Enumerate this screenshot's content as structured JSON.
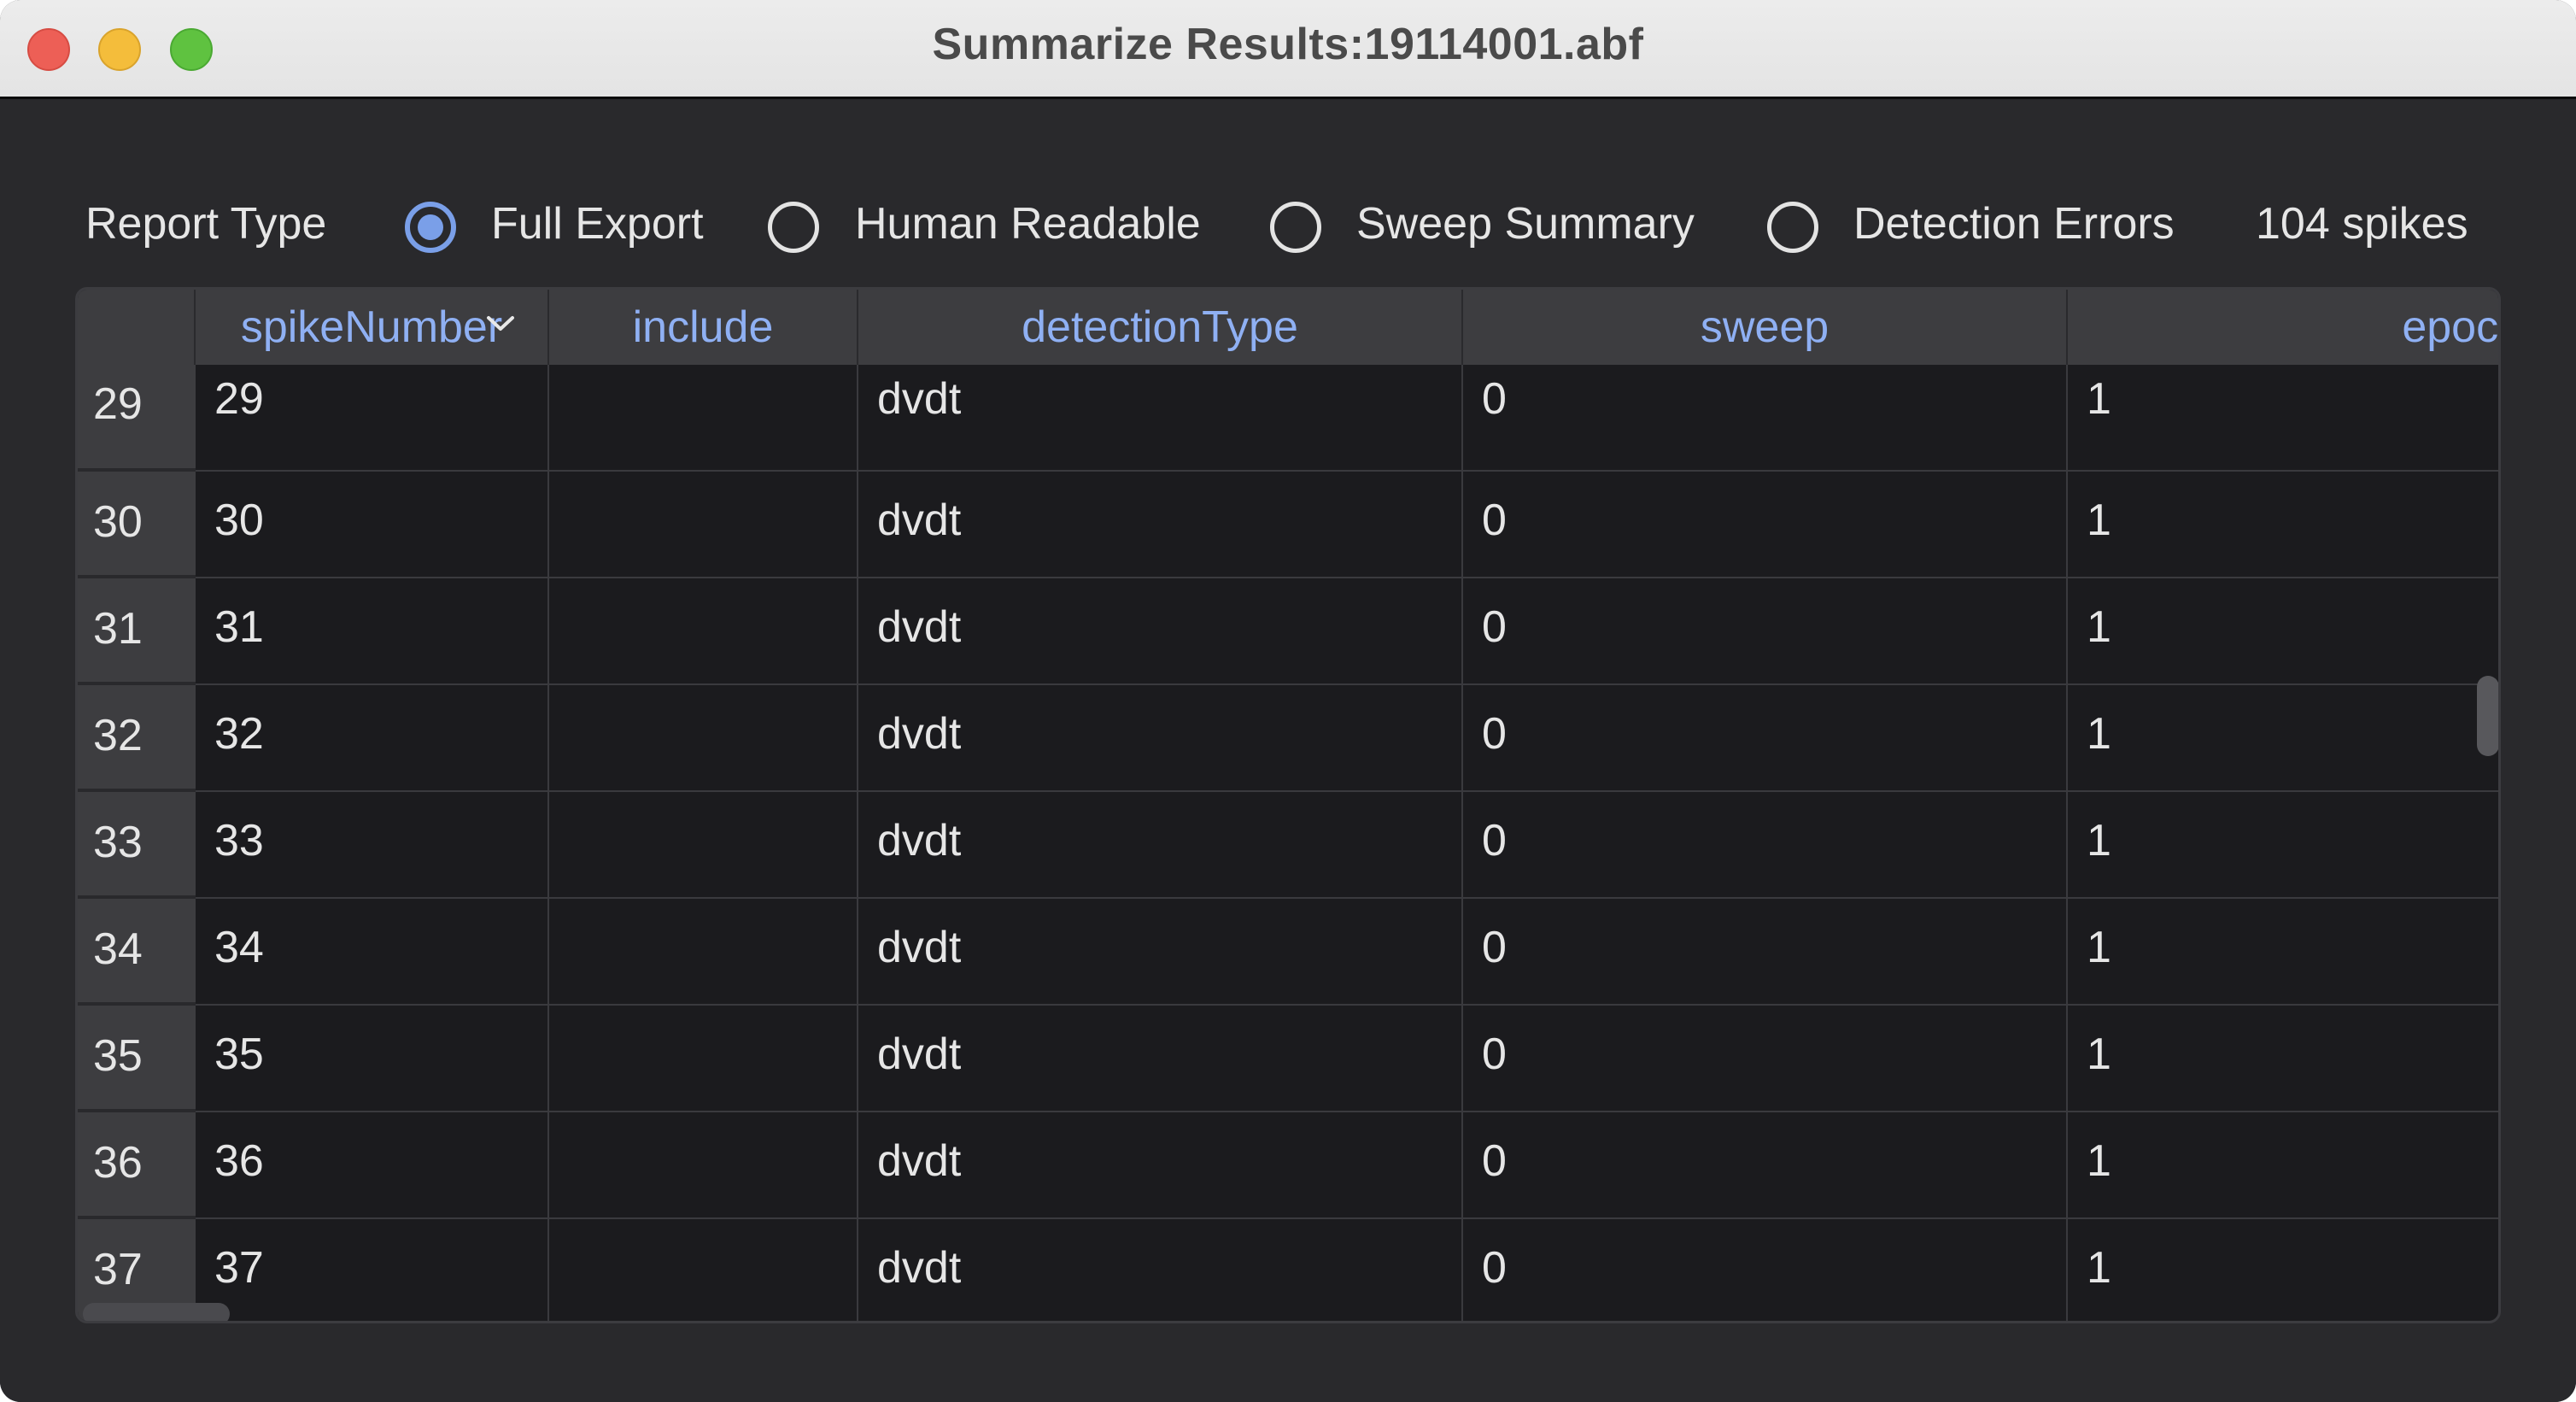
{
  "window": {
    "title": "Summarize Results:19114001.abf"
  },
  "toolbar": {
    "report_type_label": "Report Type",
    "options": [
      {
        "label": "Full Export",
        "selected": true
      },
      {
        "label": "Human Readable",
        "selected": false
      },
      {
        "label": "Sweep Summary",
        "selected": false
      },
      {
        "label": "Detection Errors",
        "selected": false
      }
    ],
    "spike_count": "104 spikes"
  },
  "table": {
    "columns": [
      "spikeNumber",
      "include",
      "detectionType",
      "sweep",
      "epoch"
    ],
    "sorted_column": "spikeNumber",
    "rows": [
      {
        "index": "29",
        "cells": [
          "29",
          "",
          "dvdt",
          "0",
          "1"
        ]
      },
      {
        "index": "30",
        "cells": [
          "30",
          "",
          "dvdt",
          "0",
          "1"
        ]
      },
      {
        "index": "31",
        "cells": [
          "31",
          "",
          "dvdt",
          "0",
          "1"
        ]
      },
      {
        "index": "32",
        "cells": [
          "32",
          "",
          "dvdt",
          "0",
          "1"
        ]
      },
      {
        "index": "33",
        "cells": [
          "33",
          "",
          "dvdt",
          "0",
          "1"
        ]
      },
      {
        "index": "34",
        "cells": [
          "34",
          "",
          "dvdt",
          "0",
          "1"
        ]
      },
      {
        "index": "35",
        "cells": [
          "35",
          "",
          "dvdt",
          "0",
          "1"
        ]
      },
      {
        "index": "36",
        "cells": [
          "36",
          "",
          "dvdt",
          "0",
          "1"
        ]
      },
      {
        "index": "37",
        "cells": [
          "37",
          "",
          "dvdt",
          "0",
          "1"
        ]
      }
    ]
  },
  "colors": {
    "accent": "#7a9fe8",
    "header_text": "#8fb0f3",
    "background": "#29292c",
    "table_background": "#1b1b1e"
  }
}
